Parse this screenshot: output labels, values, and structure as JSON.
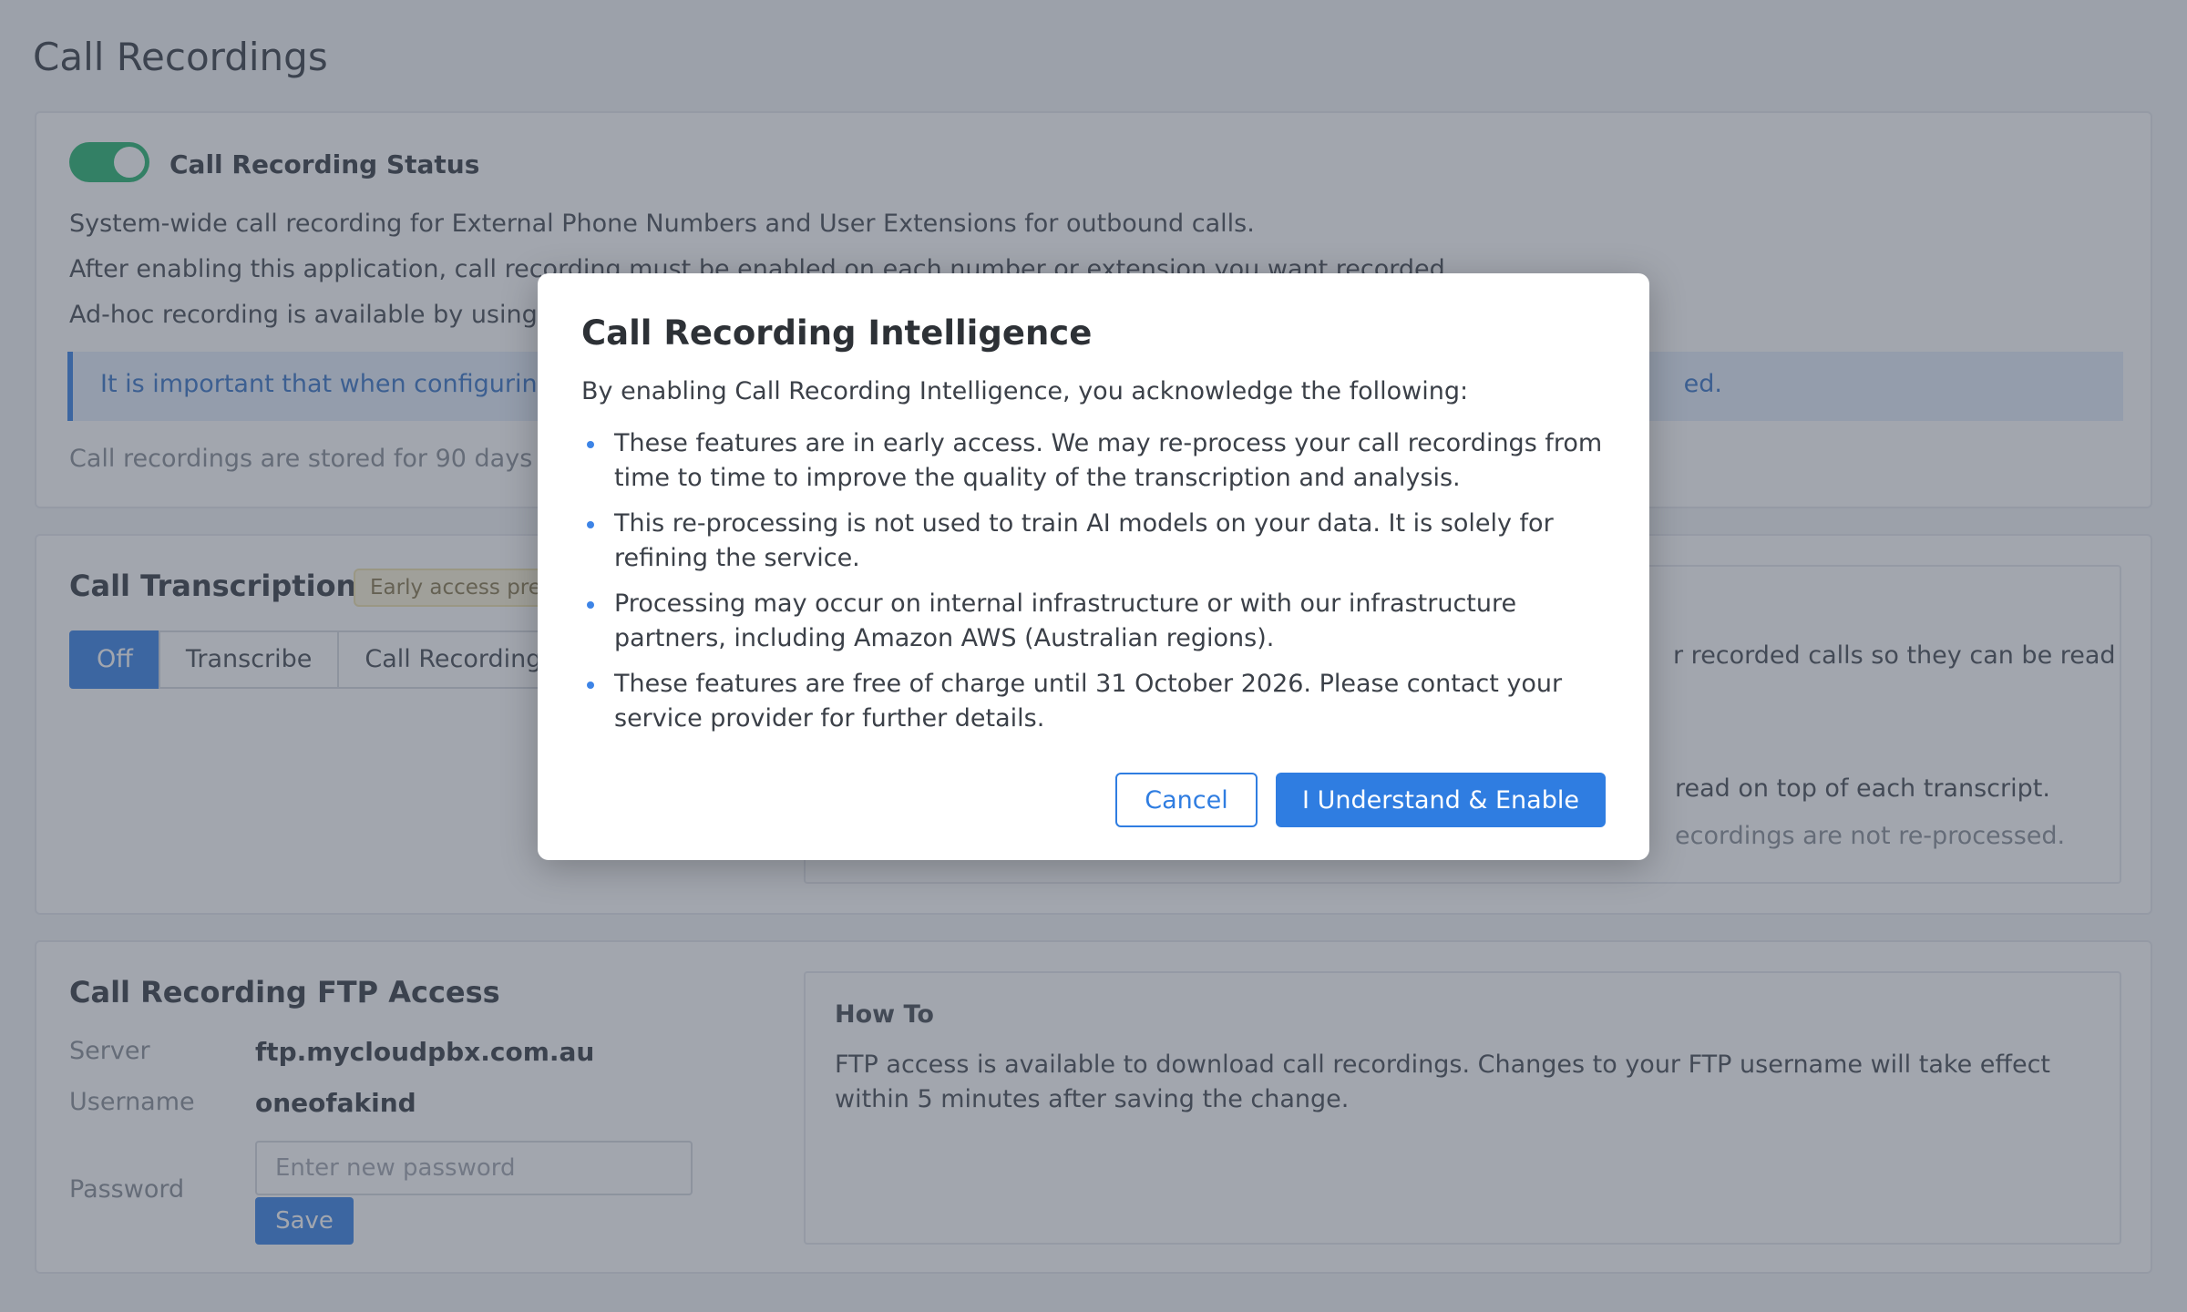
{
  "page": {
    "title": "Call Recordings"
  },
  "recording_status": {
    "label": "Call Recording Status",
    "enabled": true,
    "line1": "System-wide call recording for External Phone Numbers and User Extensions for outbound calls.",
    "line2": "After enabling this application, call recording must be enabled on each number or extension you want recorded.",
    "line3": "Ad-hoc recording is available by using t",
    "info_start": "It is important that when configuring",
    "info_end": "ed.",
    "stored": "Call recordings are stored for 90 days f"
  },
  "transcription": {
    "title": "Call Transcription",
    "badge": "Early access preview",
    "modes": [
      "Off",
      "Transcribe",
      "Call Recording"
    ],
    "active_mode": "Off",
    "panel_line1": "r recorded calls so they can be read",
    "panel_line2": "read on top of each transcript.",
    "panel_line3": "ecordings are not re-processed."
  },
  "ftp": {
    "title": "Call Recording FTP Access",
    "server_label": "Server",
    "server_value": "ftp.mycloudpbx.com.au",
    "username_label": "Username",
    "username_value": "oneofakind",
    "password_label": "Password",
    "password_placeholder": "Enter new password",
    "save_label": "Save",
    "howto_title": "How To",
    "howto_text": "FTP access is available to download call recordings. Changes to your FTP username will take effect within 5 minutes after saving the change."
  },
  "modal": {
    "title": "Call Recording Intelligence",
    "intro": "By enabling Call Recording Intelligence, you acknowledge the following:",
    "bullets": [
      "These features are in early access. We may re-process your call recordings from time to time to improve the quality of the transcription and analysis.",
      "This re-processing is not used to train AI models on your data. It is solely for refining the service.",
      "Processing may occur on internal infrastructure or with our infrastructure partners, including Amazon AWS (Australian regions).",
      "These features are free of charge until 31 October 2026. Please contact your service provider for further details."
    ],
    "cancel_label": "Cancel",
    "enable_label": "I Understand & Enable"
  },
  "colors": {
    "accent": "#2f7de1",
    "toggle_on": "#2bb673",
    "info_bg": "#e4eefc"
  }
}
